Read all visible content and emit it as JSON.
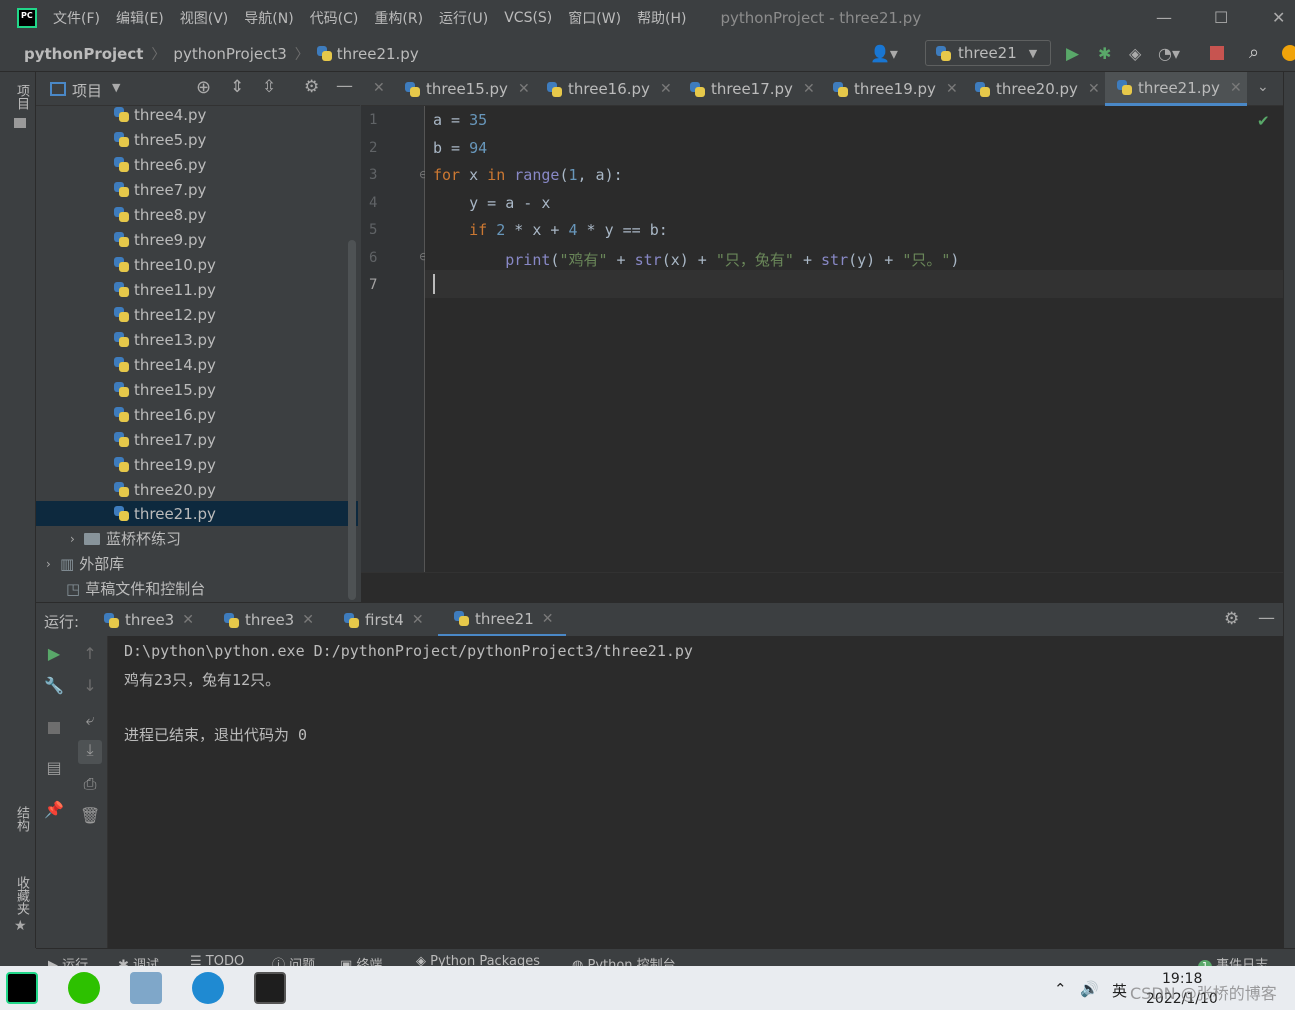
{
  "window": {
    "title": "pythonProject - three21.py",
    "menu": [
      "文件(F)",
      "编辑(E)",
      "视图(V)",
      "导航(N)",
      "代码(C)",
      "重构(R)",
      "运行(U)",
      "VCS(S)",
      "窗口(W)",
      "帮助(H)"
    ]
  },
  "navbar": {
    "crumbs": [
      "pythonProject",
      "pythonProject3",
      "three21.py"
    ],
    "run_config": "three21"
  },
  "left_strip": {
    "project_label": "项目",
    "structure_label": "结构",
    "favorites_label": "收藏夹"
  },
  "project_panel": {
    "title": "项目",
    "files": [
      "three4.py",
      "three5.py",
      "three6.py",
      "three7.py",
      "three8.py",
      "three9.py",
      "three10.py",
      "three11.py",
      "three12.py",
      "three13.py",
      "three14.py",
      "three15.py",
      "three16.py",
      "three17.py",
      "three19.py",
      "three20.py",
      "three21.py"
    ],
    "selected": "three21.py",
    "folder": "蓝桥杯练习",
    "external_libs": "外部库",
    "scratches": "草稿文件和控制台"
  },
  "editor": {
    "tabs": [
      "three15.py",
      "three16.py",
      "three17.py",
      "three19.py",
      "three20.py",
      "three21.py"
    ],
    "active_tab": "three21.py",
    "line_numbers": [
      "1",
      "2",
      "3",
      "4",
      "5",
      "6",
      "7"
    ]
  },
  "run_panel": {
    "label": "运行:",
    "tabs": [
      "three3",
      "three3",
      "first4",
      "three21"
    ],
    "active_tab": "three21",
    "console": [
      "D:\\python\\python.exe D:/pythonProject/pythonProject3/three21.py",
      "鸡有23只，兔有12只。",
      "",
      "进程已结束，退出代码为 0"
    ]
  },
  "bottom_tools": [
    "运行",
    "调试",
    "TODO",
    "问题",
    "终端",
    "Python Packages",
    "Python 控制台",
    "事件日志"
  ],
  "bottom_tools_event_count": "1",
  "taskbar": {
    "time": "19:18",
    "date": "2022/1/10",
    "ime": "英",
    "watermark": "CSDN @张桥的博客"
  }
}
